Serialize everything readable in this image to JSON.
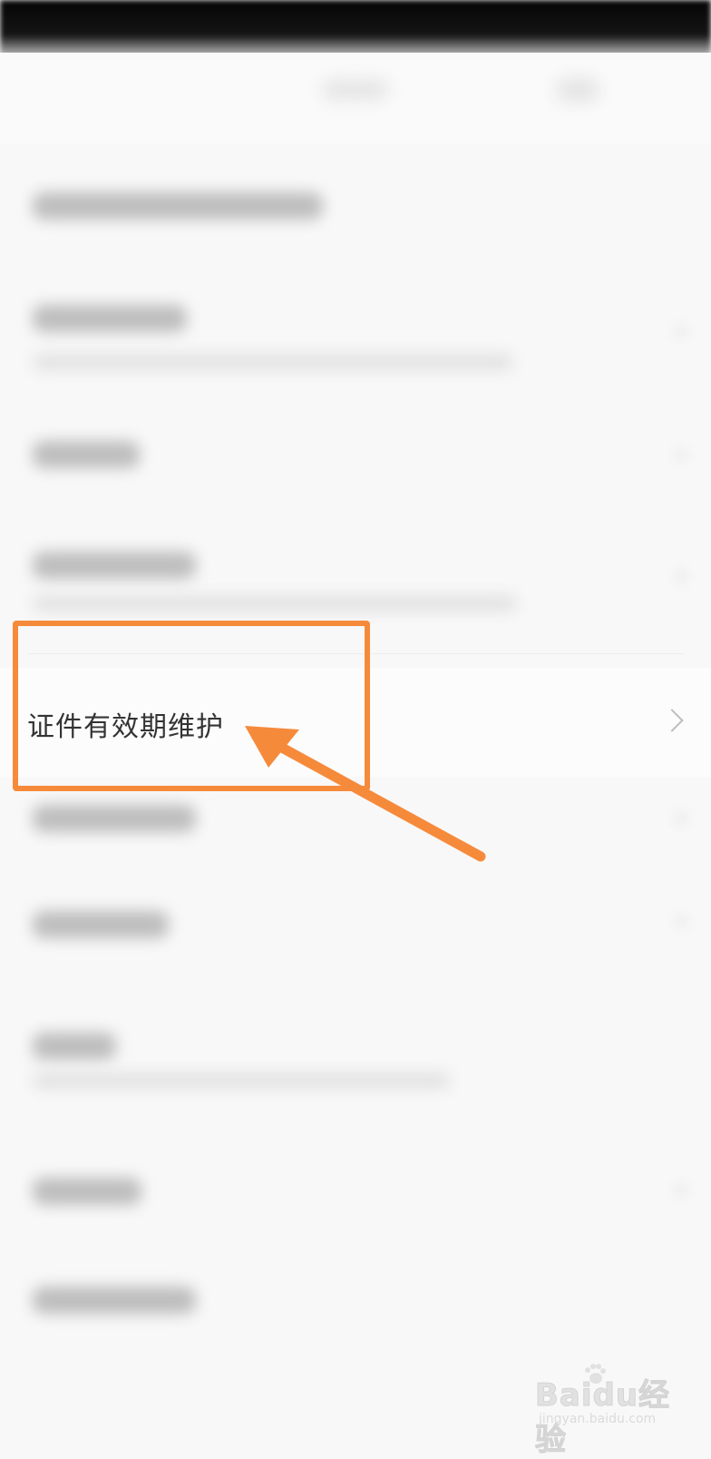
{
  "maintenance_item": {
    "label": "证件有效期维护"
  },
  "annotation": {
    "box_color": "#f68a3b",
    "arrow_color": "#f68a3b"
  },
  "watermark": {
    "brand_text": "Baidu经验",
    "url_text": "jingyan.baidu.com"
  },
  "icons": {
    "chevron": "chevron-right-icon",
    "watermark_logo": "paw-icon"
  }
}
